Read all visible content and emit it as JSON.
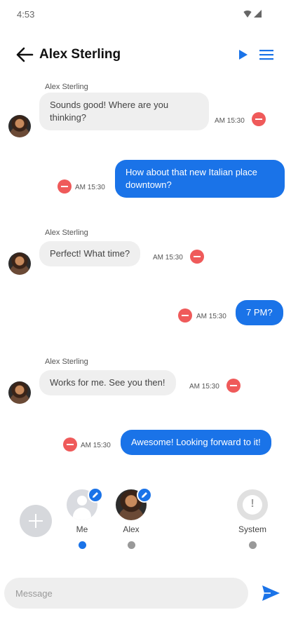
{
  "status_bar": {
    "time": "4:53"
  },
  "header": {
    "title": "Alex Sterling",
    "accent_color": "#1a73e8"
  },
  "messages": [
    {
      "direction": "incoming",
      "sender": "Alex Sterling",
      "text": "Sounds good! Where are you thinking?",
      "time": "AM 15:30"
    },
    {
      "direction": "outgoing",
      "text": "How about that new Italian place downtown?",
      "time": "AM 15:30"
    },
    {
      "direction": "incoming",
      "sender": "Alex Sterling",
      "text": "Perfect! What time?",
      "time": "AM 15:30"
    },
    {
      "direction": "outgoing",
      "text": "7 PM?",
      "time": "AM 15:30"
    },
    {
      "direction": "incoming",
      "sender": "Alex Sterling",
      "text": "Works for me. See you then!",
      "time": "AM 15:30"
    },
    {
      "direction": "outgoing",
      "text": "Awesome! Looking forward to it!",
      "time": "AM 15:30"
    }
  ],
  "participants": [
    {
      "label": "Me",
      "selected": true,
      "icon": "person-icon"
    },
    {
      "label": "Alex",
      "selected": false,
      "icon": "avatar-photo"
    },
    {
      "label": "System",
      "selected": false,
      "icon": "alert-icon"
    }
  ],
  "composer": {
    "placeholder": "Message"
  },
  "colors": {
    "incoming_bubble": "#efefef",
    "outgoing_bubble": "#1a73e8",
    "delete": "#ef5a5a"
  }
}
